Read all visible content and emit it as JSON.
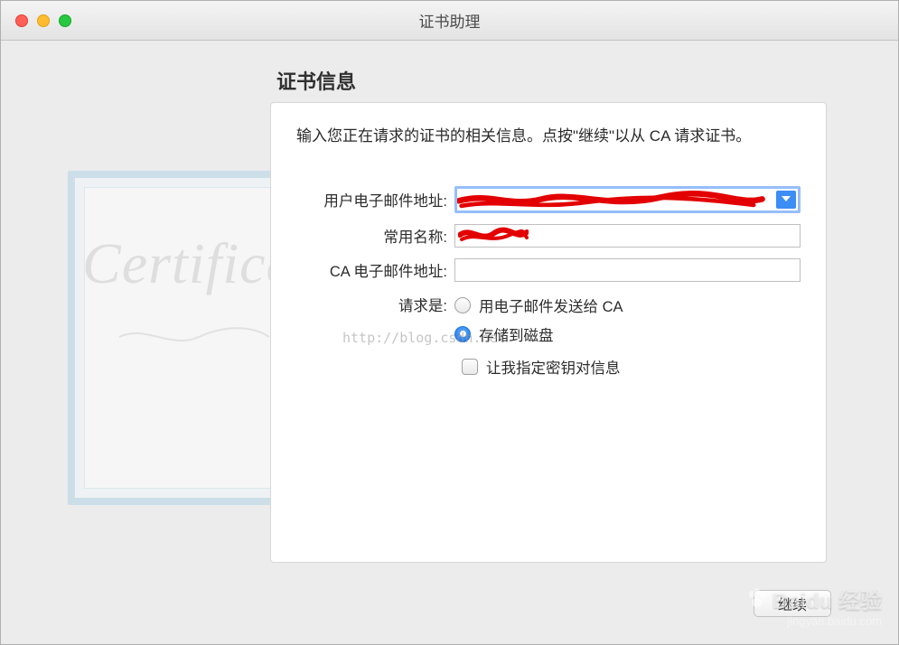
{
  "window": {
    "title": "证书助理"
  },
  "section": {
    "title": "证书信息"
  },
  "instruction": "输入您正在请求的证书的相关信息。点按\"继续\"以从 CA 请求证书。",
  "form": {
    "email_label": "用户电子邮件地址:",
    "email_value": "",
    "common_name_label": "常用名称:",
    "common_name_value": "",
    "ca_email_label": "CA 电子邮件地址:",
    "ca_email_value": "",
    "request_label": "请求是:",
    "radio_options": [
      {
        "label": "用电子邮件发送给 CA",
        "selected": false
      },
      {
        "label": "存储到磁盘",
        "selected": true
      }
    ],
    "checkbox": {
      "label": "让我指定密钥对信息",
      "checked": false
    }
  },
  "buttons": {
    "continue": "继续"
  },
  "decor": {
    "script_text": "Certificate"
  },
  "watermark": {
    "url": "http://blog.csdn.net",
    "brand": "Baidu 经验",
    "sub": "jingyan.baidu.com"
  }
}
